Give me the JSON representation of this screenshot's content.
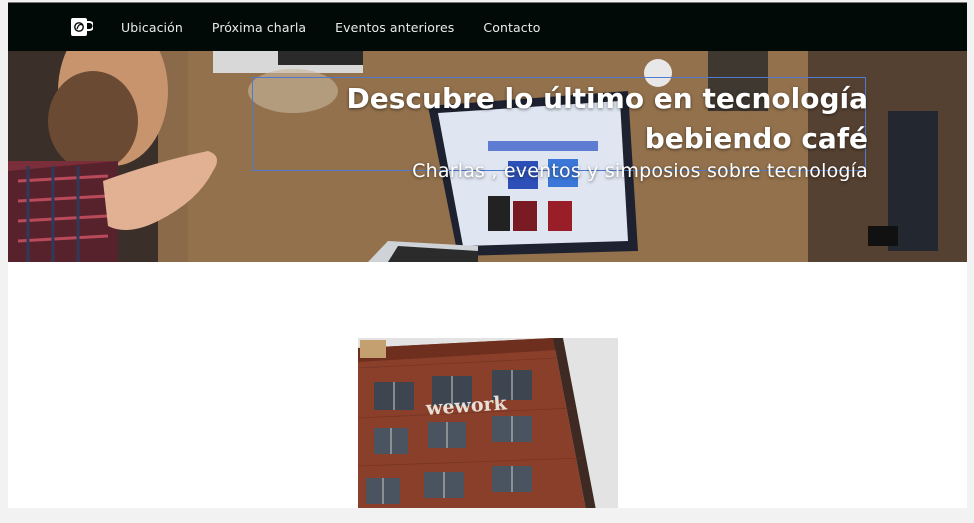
{
  "navbar": {
    "logo_icon": "coffee-cup-logo-icon",
    "links": [
      {
        "label": "Ubicación"
      },
      {
        "label": "Próxima charla"
      },
      {
        "label": "Eventos anteriores"
      },
      {
        "label": "Contacto"
      }
    ]
  },
  "hero": {
    "title_line1": "Descubre lo último en tecnología",
    "title_line2": "bebiendo café",
    "subtitle": "Charlas , eventos y simposios sobre tecnología"
  },
  "venue_image": {
    "sign_text": "wework"
  },
  "colors": {
    "navbar_bg": "#020a07",
    "nav_text": "#e8ecea",
    "selection_outline": "#4f7ad0"
  }
}
